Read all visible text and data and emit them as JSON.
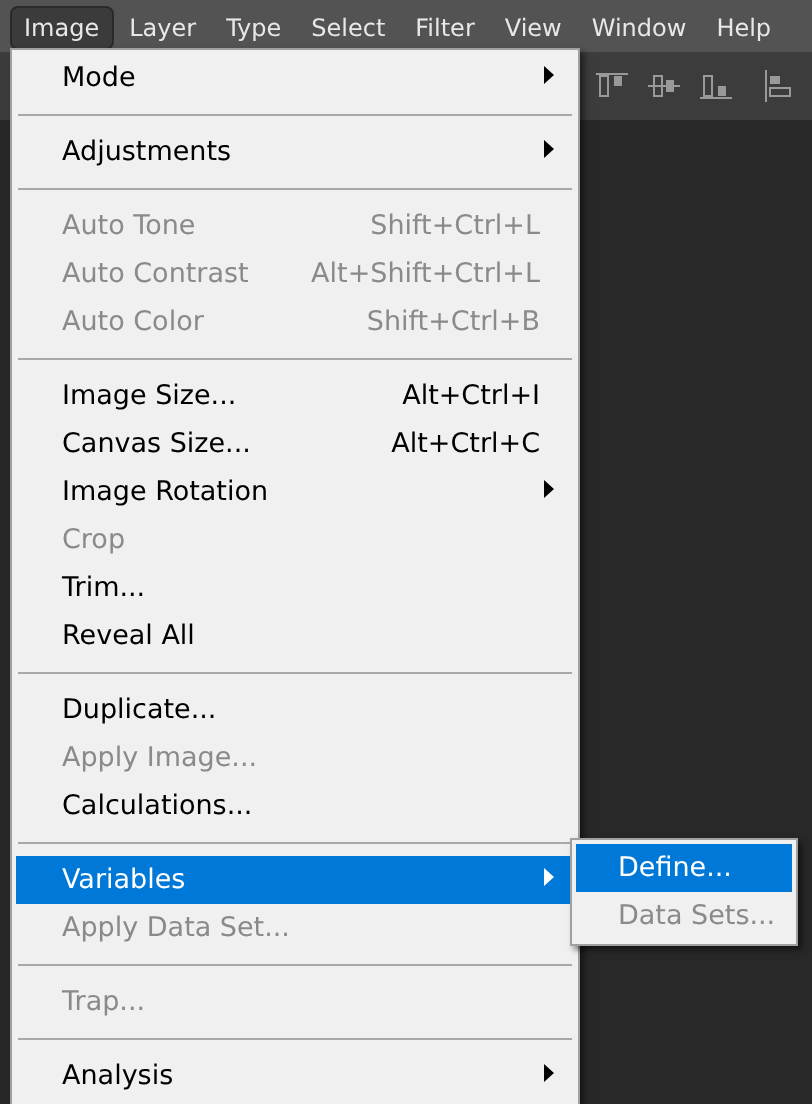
{
  "menubar": [
    {
      "label": "Image",
      "selected": true
    },
    {
      "label": "Layer",
      "selected": false
    },
    {
      "label": "Type",
      "selected": false
    },
    {
      "label": "Select",
      "selected": false
    },
    {
      "label": "Filter",
      "selected": false
    },
    {
      "label": "View",
      "selected": false
    },
    {
      "label": "Window",
      "selected": false
    },
    {
      "label": "Help",
      "selected": false
    }
  ],
  "menu": {
    "items": [
      {
        "kind": "item",
        "label": "Mode",
        "has_submenu": true,
        "disabled": false,
        "selected": false
      },
      {
        "kind": "separator"
      },
      {
        "kind": "item",
        "label": "Adjustments",
        "has_submenu": true,
        "disabled": false,
        "selected": false
      },
      {
        "kind": "separator"
      },
      {
        "kind": "item",
        "label": "Auto Tone",
        "shortcut": "Shift+Ctrl+L",
        "disabled": true,
        "selected": false
      },
      {
        "kind": "item",
        "label": "Auto Contrast",
        "shortcut": "Alt+Shift+Ctrl+L",
        "disabled": true,
        "selected": false
      },
      {
        "kind": "item",
        "label": "Auto Color",
        "shortcut": "Shift+Ctrl+B",
        "disabled": true,
        "selected": false
      },
      {
        "kind": "separator"
      },
      {
        "kind": "item",
        "label": "Image Size...",
        "shortcut": "Alt+Ctrl+I",
        "disabled": false,
        "selected": false
      },
      {
        "kind": "item",
        "label": "Canvas Size...",
        "shortcut": "Alt+Ctrl+C",
        "disabled": false,
        "selected": false
      },
      {
        "kind": "item",
        "label": "Image Rotation",
        "has_submenu": true,
        "disabled": false,
        "selected": false
      },
      {
        "kind": "item",
        "label": "Crop",
        "disabled": true,
        "selected": false
      },
      {
        "kind": "item",
        "label": "Trim...",
        "disabled": false,
        "selected": false
      },
      {
        "kind": "item",
        "label": "Reveal All",
        "disabled": false,
        "selected": false
      },
      {
        "kind": "separator"
      },
      {
        "kind": "item",
        "label": "Duplicate...",
        "disabled": false,
        "selected": false
      },
      {
        "kind": "item",
        "label": "Apply Image...",
        "disabled": true,
        "selected": false
      },
      {
        "kind": "item",
        "label": "Calculations...",
        "disabled": false,
        "selected": false
      },
      {
        "kind": "separator"
      },
      {
        "kind": "item",
        "label": "Variables",
        "has_submenu": true,
        "disabled": false,
        "selected": true
      },
      {
        "kind": "item",
        "label": "Apply Data Set...",
        "disabled": true,
        "selected": false
      },
      {
        "kind": "separator"
      },
      {
        "kind": "item",
        "label": "Trap...",
        "disabled": true,
        "selected": false
      },
      {
        "kind": "separator"
      },
      {
        "kind": "item",
        "label": "Analysis",
        "has_submenu": true,
        "disabled": false,
        "selected": false
      }
    ]
  },
  "submenu": {
    "items": [
      {
        "label": "Define...",
        "disabled": false,
        "selected": true
      },
      {
        "label": "Data Sets...",
        "disabled": true,
        "selected": false
      }
    ]
  }
}
